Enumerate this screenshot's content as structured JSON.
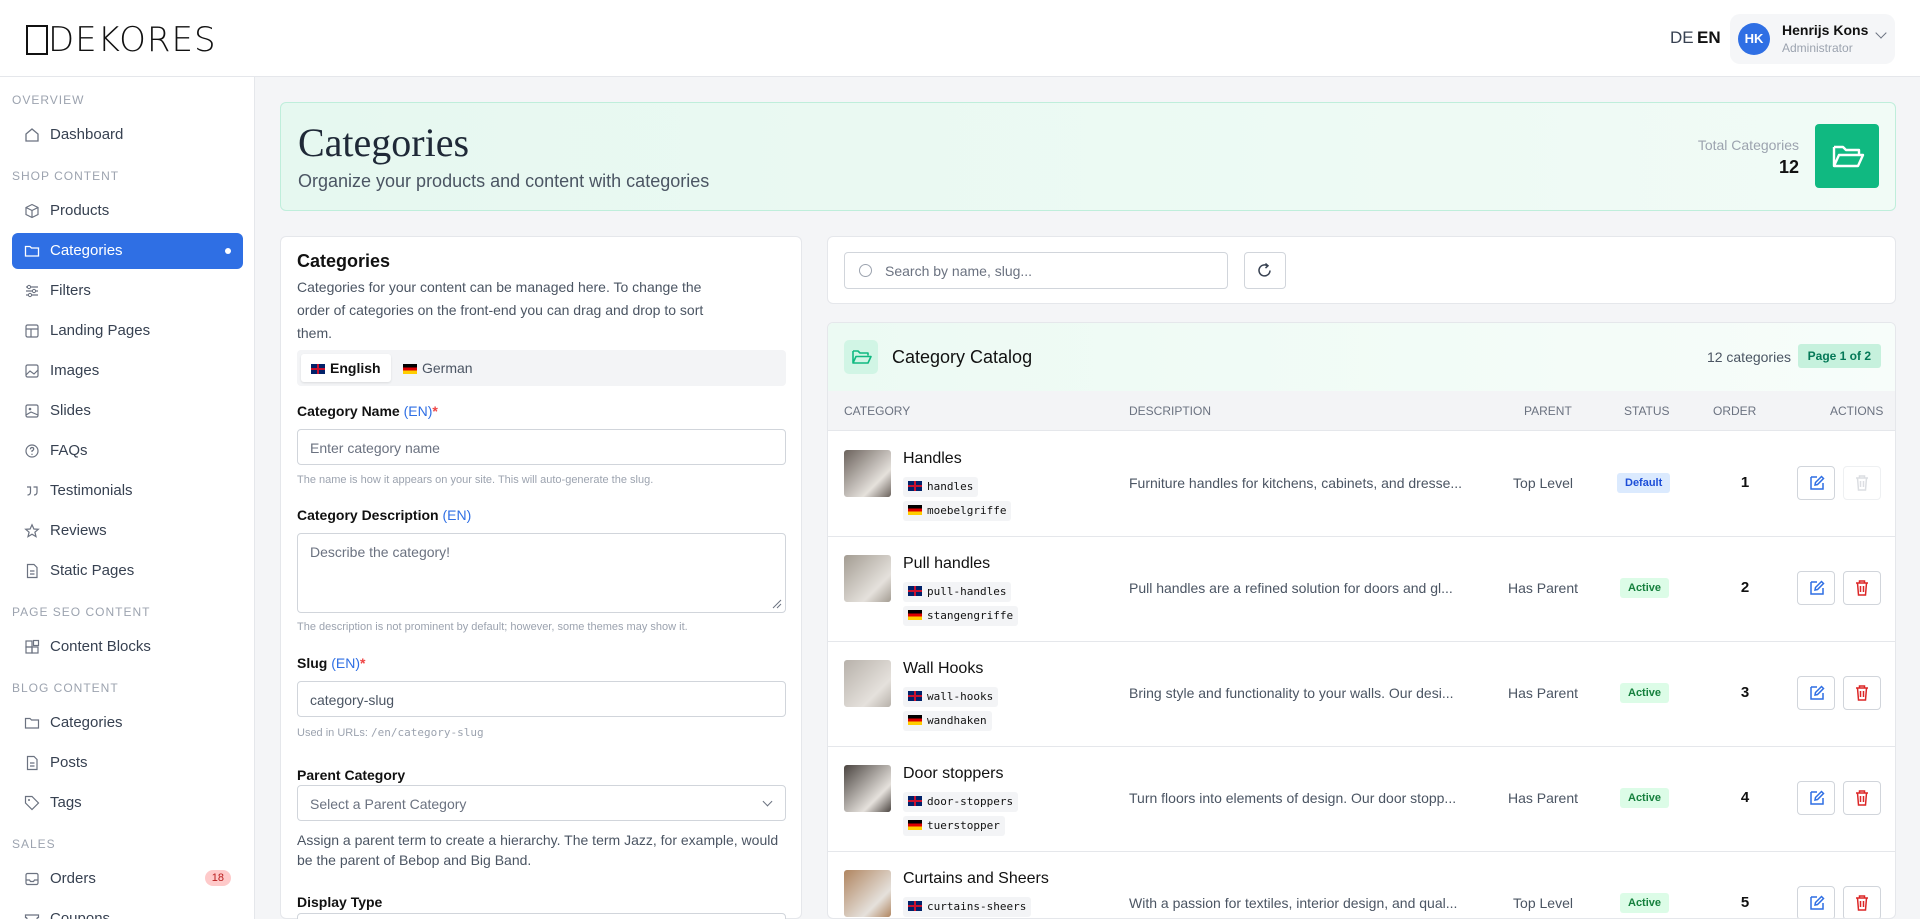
{
  "header": {
    "logo": "DEKORES",
    "lang_de": "DE",
    "lang_en": "EN",
    "user_initials": "HK",
    "user_name": "Henrijs Kons",
    "user_role": "Administrator"
  },
  "sidebar": {
    "sections": [
      {
        "title": "OVERVIEW",
        "items": [
          {
            "label": "Dashboard",
            "icon": "home-icon"
          }
        ]
      },
      {
        "title": "SHOP CONTENT",
        "items": [
          {
            "label": "Products",
            "icon": "box-icon"
          },
          {
            "label": "Categories",
            "icon": "folder-icon",
            "active": true
          },
          {
            "label": "Filters",
            "icon": "sliders-icon"
          },
          {
            "label": "Landing Pages",
            "icon": "layout-icon"
          },
          {
            "label": "Images",
            "icon": "image-icon"
          },
          {
            "label": "Slides",
            "icon": "image-icon"
          },
          {
            "label": "FAQs",
            "icon": "help-circle-icon"
          },
          {
            "label": "Testimonials",
            "icon": "quote-icon"
          },
          {
            "label": "Reviews",
            "icon": "star-icon"
          },
          {
            "label": "Static Pages",
            "icon": "file-icon"
          }
        ]
      },
      {
        "title": "PAGE SEO CONTENT",
        "items": [
          {
            "label": "Content Blocks",
            "icon": "blocks-icon"
          }
        ]
      },
      {
        "title": "BLOG CONTENT",
        "items": [
          {
            "label": "Categories",
            "icon": "folder-icon"
          },
          {
            "label": "Posts",
            "icon": "file-icon"
          },
          {
            "label": "Tags",
            "icon": "tag-icon"
          }
        ]
      },
      {
        "title": "SALES",
        "items": [
          {
            "label": "Orders",
            "icon": "inbox-icon",
            "badge": "18"
          },
          {
            "label": "Coupons",
            "icon": "ticket-icon"
          }
        ]
      }
    ]
  },
  "hero": {
    "title": "Categories",
    "subtitle": "Organize your products and content with categories",
    "total_label": "Total Categories",
    "total_value": "12"
  },
  "form": {
    "title": "Categories",
    "intro": "Categories for your content can be managed here. To change the order of categories on the front-end you can drag and drop to sort them.",
    "tab_en": "English",
    "tab_de": "German",
    "name_label": "Category Name",
    "lang_suffix": "(EN)",
    "required_mark": "*",
    "name_placeholder": "Enter category name",
    "name_hint": "The name is how it appears on your site. This will auto-generate the slug.",
    "desc_label": "Category Description",
    "desc_placeholder": "Describe the category!",
    "desc_hint": "The description is not prominent by default; however, some themes may show it.",
    "slug_label": "Slug",
    "slug_value": "category-slug",
    "slug_hint_prefix": "Used in URLs:",
    "slug_hint_code": "/en/category-slug",
    "parent_label": "Parent Category",
    "parent_value": "Select a Parent Category",
    "parent_hint": "Assign a parent term to create a hierarchy. The term Jazz, for example, would be the parent of Bebop and Big Band.",
    "display_label": "Display Type"
  },
  "search": {
    "placeholder": "Search by name, slug..."
  },
  "catalog": {
    "title": "Category Catalog",
    "count": "12 categories",
    "page": "Page 1 of 2",
    "columns": [
      "CATEGORY",
      "DESCRIPTION",
      "PARENT",
      "STATUS",
      "ORDER",
      "ACTIONS"
    ],
    "rows": [
      {
        "name": "Handles",
        "slug_en": "handles",
        "slug_de": "moebelgriffe",
        "description": "Furniture handles for kitchens, cabinets, and dresse...",
        "parent": "Top Level",
        "status": "Default",
        "order": "1",
        "thumb": "#6b625c"
      },
      {
        "name": "Pull handles",
        "slug_en": "pull-handles",
        "slug_de": "stangengriffe",
        "description": "Pull handles are a refined solution for doors and gl...",
        "parent": "Has Parent",
        "status": "Active",
        "order": "2",
        "thumb": "#a39c92"
      },
      {
        "name": "Wall Hooks",
        "slug_en": "wall-hooks",
        "slug_de": "wandhaken",
        "description": "Bring style and functionality to your walls. Our desi...",
        "parent": "Has Parent",
        "status": "Active",
        "order": "3",
        "thumb": "#b7b1aa"
      },
      {
        "name": "Door stoppers",
        "slug_en": "door-stoppers",
        "slug_de": "tuerstopper",
        "description": "Turn floors into elements of design. Our door stopp...",
        "parent": "Has Parent",
        "status": "Active",
        "order": "4",
        "thumb": "#4a4440"
      },
      {
        "name": "Curtains and Sheers",
        "slug_en": "curtains-sheers",
        "slug_de": "",
        "description": "With a passion for textiles, interior design, and qual...",
        "parent": "Top Level",
        "status": "Active",
        "order": "5",
        "thumb": "#b08560"
      }
    ]
  }
}
